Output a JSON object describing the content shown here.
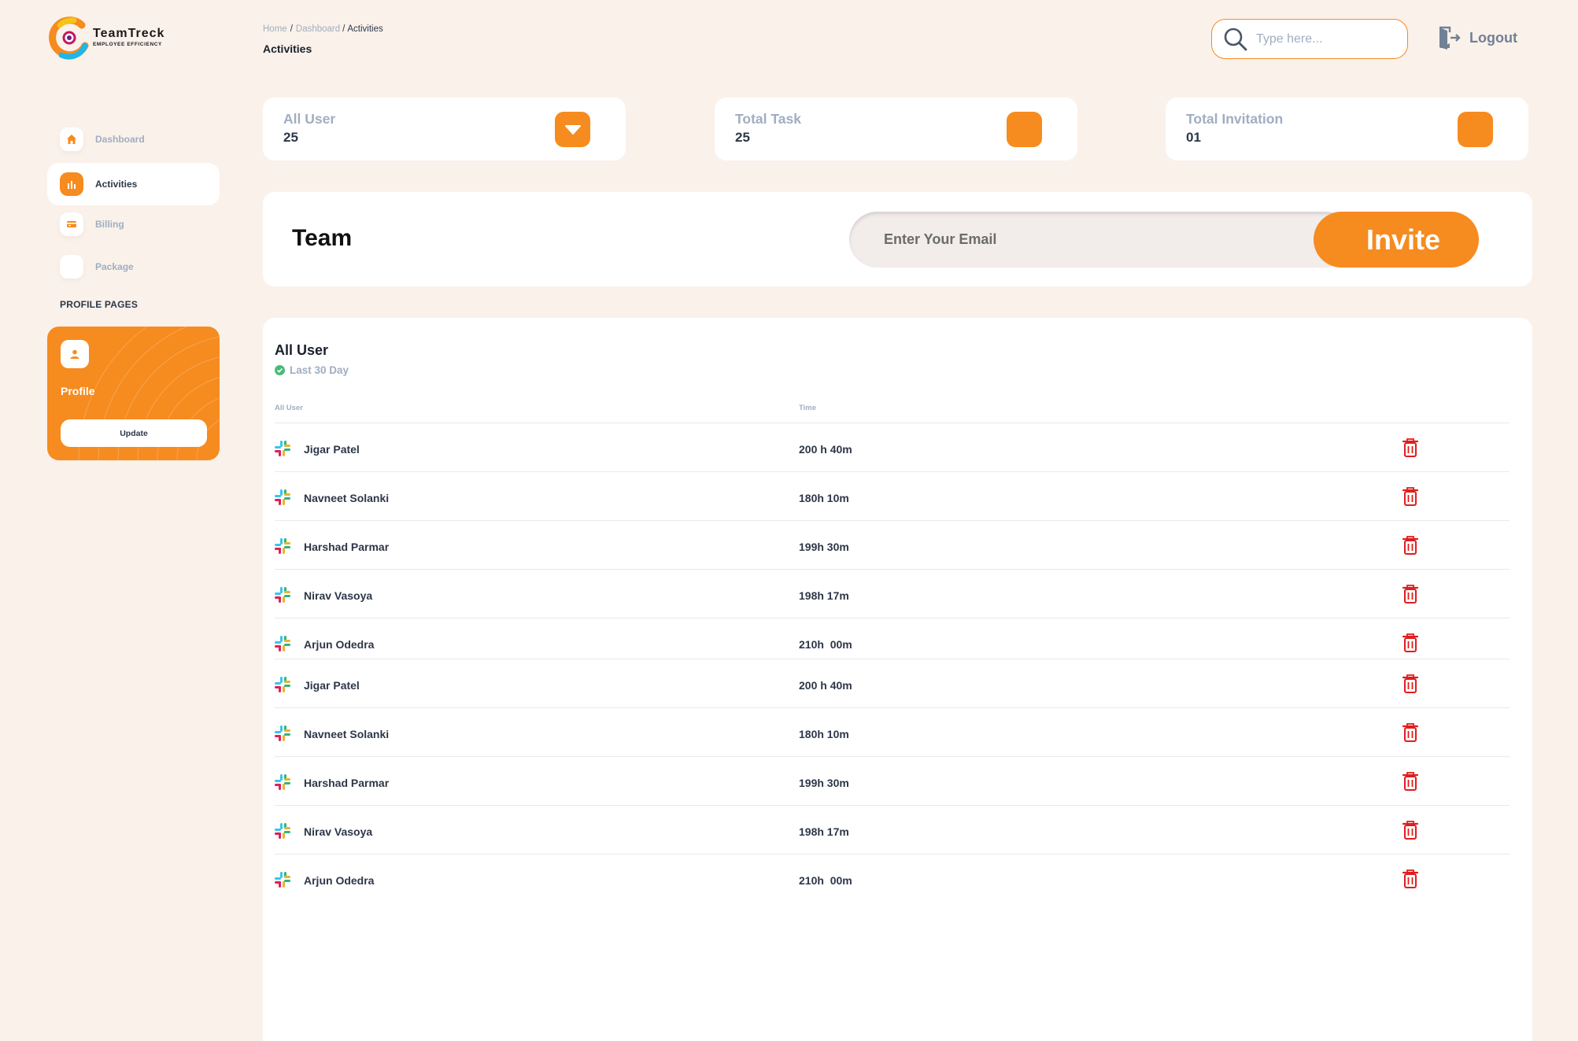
{
  "brand": {
    "name": "TeamTreck",
    "tagline": "EMPLOYEE EFFICIENCY"
  },
  "header": {
    "breadcrumb": [
      "Home",
      "Dashboard",
      "Activities"
    ],
    "title": "Activities",
    "search_placeholder": "Type here...",
    "logout_label": "Logout"
  },
  "sidebar": {
    "items": [
      {
        "label": "Dashboard",
        "icon": "home-icon",
        "active": false
      },
      {
        "label": "Activities",
        "icon": "bar-chart-icon",
        "active": true
      },
      {
        "label": "Billing",
        "icon": "credit-card-icon",
        "active": false
      },
      {
        "label": "Package",
        "icon": "",
        "active": false
      }
    ],
    "section_title": "PROFILE PAGES",
    "profile_card": {
      "label": "Profile",
      "button": "Update"
    }
  },
  "stats": [
    {
      "label": "All User",
      "value": "25",
      "icon": "chevron-down-icon"
    },
    {
      "label": "Total Task",
      "value": "25",
      "icon": ""
    },
    {
      "label": "Total Invitation",
      "value": "01",
      "icon": ""
    }
  ],
  "team": {
    "title": "Team",
    "email_placeholder": "Enter Your Email",
    "invite_label": "Invite"
  },
  "users": {
    "title": "All User",
    "subtitle": "Last 30 Day",
    "columns": [
      "All User",
      "Time"
    ],
    "rows": [
      {
        "name": "Jigar Patel",
        "time": "200 h 40m"
      },
      {
        "name": "Navneet Solanki",
        "time": "180h 10m"
      },
      {
        "name": "Harshad Parmar",
        "time": "199h 30m"
      },
      {
        "name": "Nirav Vasoya",
        "time": "198h 17m"
      },
      {
        "name": "Arjun Odedra",
        "time": "210h  00m"
      },
      {
        "name": "Jigar Patel",
        "time": "200 h 40m"
      },
      {
        "name": "Navneet Solanki",
        "time": "180h 10m"
      },
      {
        "name": "Harshad Parmar",
        "time": "199h 30m"
      },
      {
        "name": "Nirav Vasoya",
        "time": "198h 17m"
      },
      {
        "name": "Arjun Odedra",
        "time": "210h  00m"
      }
    ]
  },
  "colors": {
    "accent": "#F68B1F",
    "background": "#FAF1EA",
    "danger": "#E11D1D",
    "muted": "#A0AEC0",
    "text": "#2D3748"
  }
}
